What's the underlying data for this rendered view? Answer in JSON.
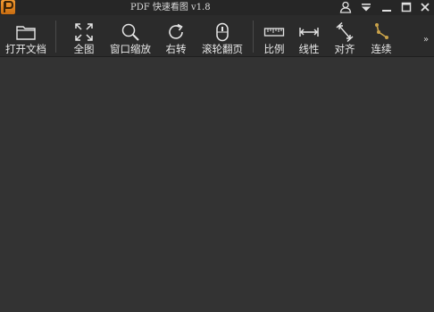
{
  "app": {
    "title": "PDF 快速看图 v1.8",
    "logo_letter": "P"
  },
  "window_controls": [
    {
      "name": "user-icon"
    },
    {
      "name": "menu-dropdown-icon"
    },
    {
      "name": "minimize-icon"
    },
    {
      "name": "maximize-icon"
    },
    {
      "name": "close-icon"
    }
  ],
  "toolbar": {
    "open_label": "打开文档",
    "fit_label": "全图",
    "zoom_label": "窗口缩放",
    "rotate_label": "右转",
    "scroll_label": "滚轮翻页",
    "scale_label": "比例",
    "linear_label": "线性",
    "align_label": "对齐",
    "continuous_label": "连续",
    "more_label": "»"
  },
  "colors": {
    "titlebar": "#262626",
    "toolbar": "#2b2b2b",
    "canvas": "#333333",
    "logo": "#e0861f",
    "accent_gold": "#c9a24a"
  }
}
